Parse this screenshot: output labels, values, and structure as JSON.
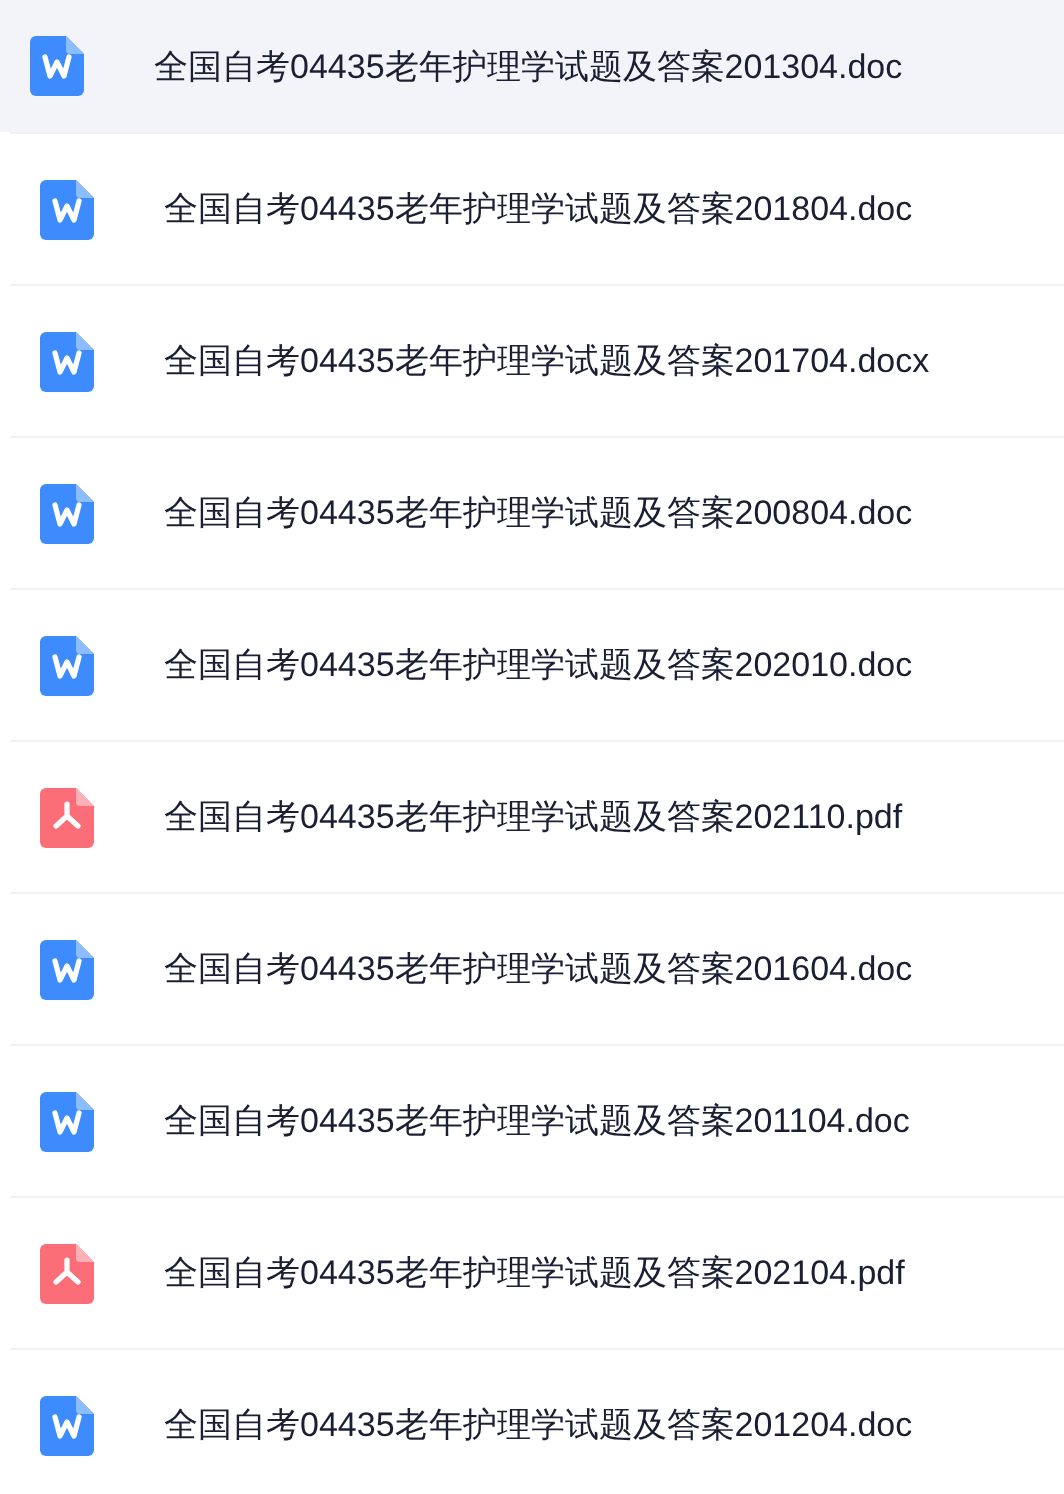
{
  "files": [
    {
      "name": "全国自考04435老年护理学试题及答案201304.doc",
      "kind": "word",
      "selected": true
    },
    {
      "name": "全国自考04435老年护理学试题及答案201804.doc",
      "kind": "word",
      "selected": false
    },
    {
      "name": "全国自考04435老年护理学试题及答案201704.docx",
      "kind": "word",
      "selected": false
    },
    {
      "name": "全国自考04435老年护理学试题及答案200804.doc",
      "kind": "word",
      "selected": false
    },
    {
      "name": "全国自考04435老年护理学试题及答案202010.doc",
      "kind": "word",
      "selected": false
    },
    {
      "name": "全国自考04435老年护理学试题及答案202110.pdf",
      "kind": "pdf",
      "selected": false
    },
    {
      "name": "全国自考04435老年护理学试题及答案201604.doc",
      "kind": "word",
      "selected": false
    },
    {
      "name": "全国自考04435老年护理学试题及答案201104.doc",
      "kind": "word",
      "selected": false
    },
    {
      "name": "全国自考04435老年护理学试题及答案202104.pdf",
      "kind": "pdf",
      "selected": false
    },
    {
      "name": "全国自考04435老年护理学试题及答案201204.doc",
      "kind": "word",
      "selected": false
    }
  ]
}
